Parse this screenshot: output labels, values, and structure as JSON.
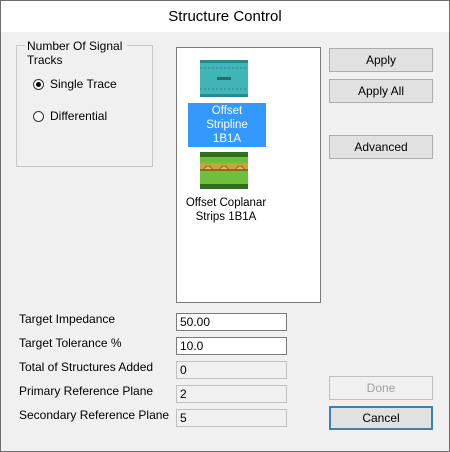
{
  "window": {
    "title": "Structure Control"
  },
  "signal_group": {
    "legend": "Number Of Signal Tracks",
    "options": [
      {
        "label": "Single Trace",
        "checked": true
      },
      {
        "label": "Differential",
        "checked": false
      }
    ]
  },
  "structures": [
    {
      "label_line1": "Offset Stripline",
      "label_line2": "1B1A",
      "selected": true,
      "icon": "offset-stripline-icon"
    },
    {
      "label_line1": "Offset Coplanar",
      "label_line2": "Strips 1B1A",
      "selected": false,
      "icon": "offset-coplanar-icon"
    }
  ],
  "buttons": {
    "apply": "Apply",
    "apply_all": "Apply All",
    "advanced": "Advanced",
    "done": "Done",
    "cancel": "Cancel"
  },
  "fields": {
    "target_impedance": {
      "label": "Target Impedance",
      "value": "50.00"
    },
    "target_tolerance": {
      "label": "Target Tolerance %",
      "value": "10.0"
    },
    "total_structures": {
      "label": "Total of Structures Added",
      "value": "0"
    },
    "primary_ref": {
      "label": "Primary Reference Plane",
      "value": "2"
    },
    "secondary_ref": {
      "label": "Secondary Reference Plane",
      "value": "5"
    }
  },
  "colors": {
    "selection": "#3399ff",
    "stripline_fill": "#3fb5b5",
    "coplanar_fill": "#6fbf3f",
    "coplanar_band": "#c8a23c"
  }
}
